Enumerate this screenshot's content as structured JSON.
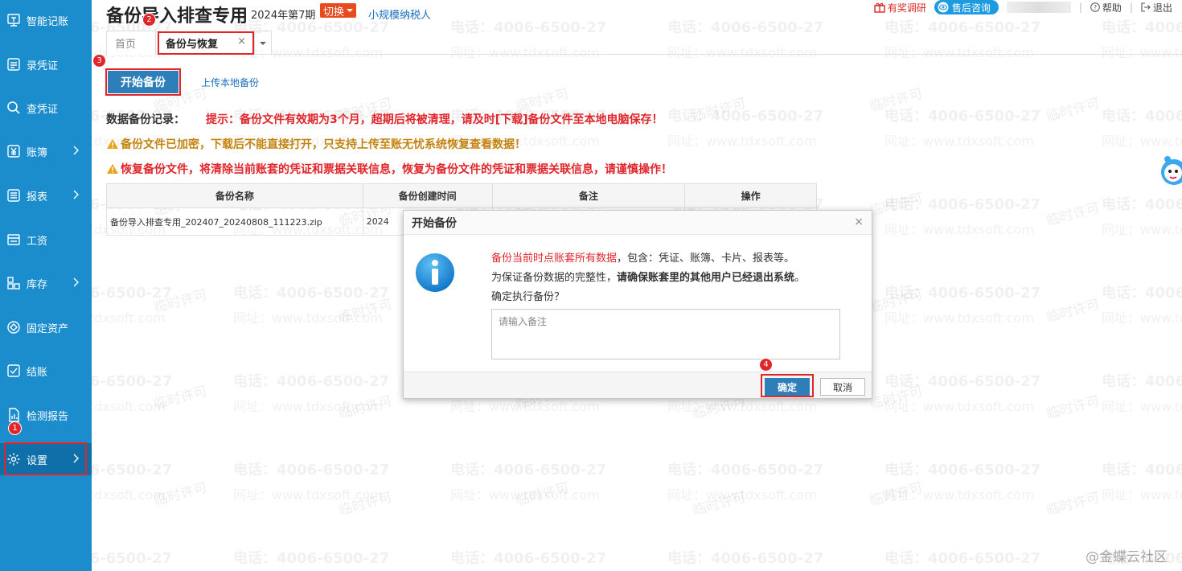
{
  "sidebar": {
    "items": [
      {
        "label": "智能记账",
        "icon": "smart-bookkeeping-icon"
      },
      {
        "label": "录凭证",
        "icon": "enter-voucher-icon"
      },
      {
        "label": "查凭证",
        "icon": "search-icon"
      },
      {
        "label": "账簿",
        "icon": "yen-icon"
      },
      {
        "label": "报表",
        "icon": "list-icon"
      },
      {
        "label": "工资",
        "icon": "salary-icon"
      },
      {
        "label": "库存",
        "icon": "inventory-icon"
      },
      {
        "label": "固定资产",
        "icon": "fixed-asset-icon"
      },
      {
        "label": "结账",
        "icon": "checkbox-icon"
      },
      {
        "label": "检测报告",
        "icon": "report-icon"
      },
      {
        "label": "设置",
        "icon": "gear-icon"
      }
    ]
  },
  "header": {
    "title": "备份导入排查专用",
    "period": "2024年第7期",
    "switch_label": "切换",
    "taxpayer": "小规模纳税人",
    "survey": "有奖调研",
    "support": "售后咨询",
    "help": "帮助",
    "logout": "退出"
  },
  "tabs": {
    "home": "首页",
    "backup": "备份与恢复",
    "close": "×"
  },
  "badges": [
    "1",
    "2",
    "3",
    "4"
  ],
  "main": {
    "start_button": "开始备份",
    "upload_link": "上传本地备份",
    "record_label": "数据备份记录：",
    "tip": "提示：备份文件有效期为3个月，超期后将被清理，请及时[下载]备份文件至本地电脑保存！",
    "warning1": "备份文件已加密，下载后不能直接打开，只支持上传至账无忧系统恢复查看数据！",
    "warning2": "恢复备份文件，将清除当前账套的凭证和票据关联信息，恢复为备份文件的凭证和票据关联信息，请谨慎操作！"
  },
  "table": {
    "headers": [
      "备份名称",
      "备份创建时间",
      "",
      "备注",
      "操作"
    ],
    "rows": [
      [
        "备份导入排查专用_202407_20240808_111223.zip",
        "2024",
        "",
        "",
        ""
      ]
    ]
  },
  "dialog": {
    "title": "开始备份",
    "close": "×",
    "line1_red": "备份当前时点账套所有数据",
    "line1_rest": "，包含：凭证、账簿、卡片、报表等。",
    "line2_pre": "为保证备份数据的完整性，",
    "line2_bold": "请确保账套里的其他用户已经退出系统",
    "line2_end": "。",
    "line3": "确定执行备份？",
    "remark_placeholder": "请输入备注",
    "ok": "确定",
    "cancel": "取消"
  },
  "watermark": {
    "phone": "电话：4006-6500-27",
    "site": "网址：www.tdxsoft.com",
    "temp": "临时许可"
  },
  "footer": {
    "community": "@金蝶云社区"
  },
  "colors": {
    "sidebar": "#1b8ccc",
    "primary": "#2d7eb9",
    "alert": "#e0262b",
    "warning": "#c3830f"
  }
}
